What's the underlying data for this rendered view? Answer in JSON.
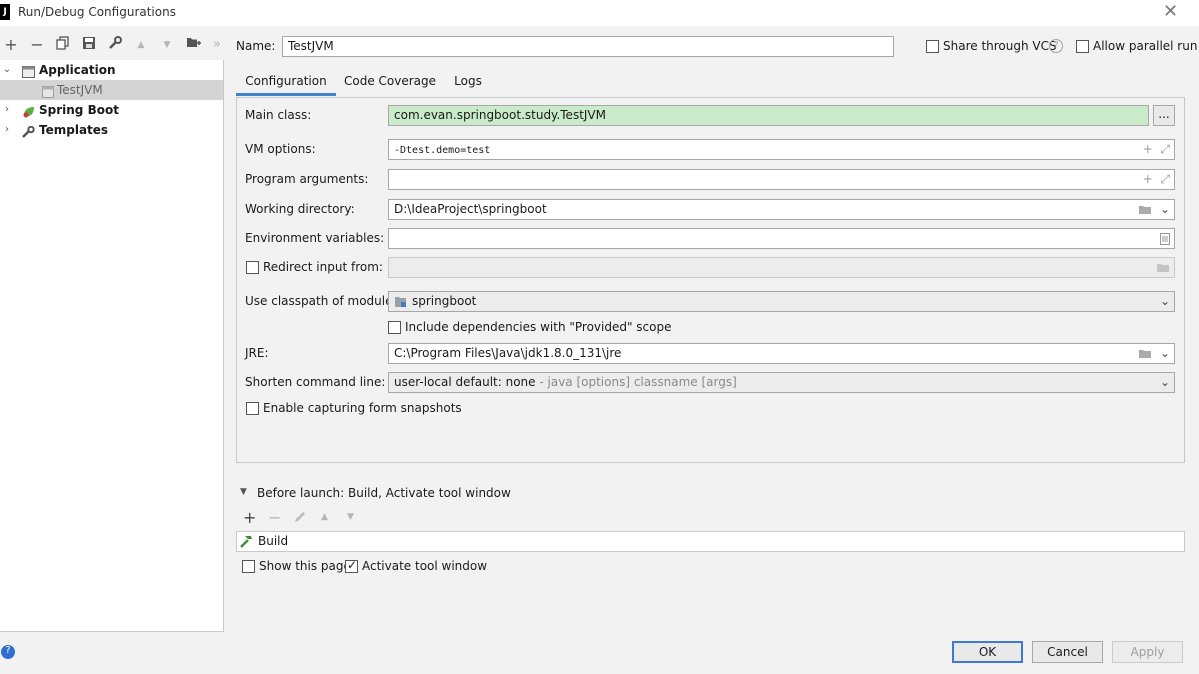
{
  "window": {
    "title": "Run/Debug Configurations",
    "app_icon_letter": "J"
  },
  "toolbar": {
    "add": "+",
    "remove": "−",
    "copy": "⧉",
    "save": "💾",
    "wrench": "🔧",
    "up": "▲",
    "down": "▼",
    "folder": "📁",
    "more": "»"
  },
  "tree": {
    "items": [
      {
        "label": "Application",
        "expanded": true,
        "bold": true
      },
      {
        "label": "TestJVM",
        "selected": true
      },
      {
        "label": "Spring Boot",
        "expanded": false,
        "bold": true
      },
      {
        "label": "Templates",
        "expanded": false,
        "bold": true
      }
    ]
  },
  "header": {
    "name_label": "Name:",
    "name_value": "TestJVM",
    "share_vcs_label": "Share through VCS",
    "allow_parallel_label": "Allow parallel run"
  },
  "tabs": [
    {
      "label": "Configuration",
      "active": true
    },
    {
      "label": "Code Coverage",
      "active": false
    },
    {
      "label": "Logs",
      "active": false
    }
  ],
  "form": {
    "main_class_label": "Main class:",
    "main_class_value": "com.evan.springboot.study.TestJVM",
    "browse_label": "...",
    "vm_options_label": "VM options:",
    "vm_options_value": "-Dtest.demo=test",
    "program_args_label": "Program arguments:",
    "program_args_value": "",
    "working_dir_label": "Working directory:",
    "working_dir_value": "D:\\IdeaProject\\springboot",
    "env_vars_label": "Environment variables:",
    "env_vars_value": "",
    "redirect_input_label": "Redirect input from:",
    "classpath_label": "Use classpath of module:",
    "classpath_value": "springboot",
    "include_deps_label": "Include dependencies with \"Provided\" scope",
    "jre_label": "JRE:",
    "jre_value": "C:\\Program Files\\Java\\jdk1.8.0_131\\jre",
    "shorten_label": "Shorten command line:",
    "shorten_value": "user-local default: none",
    "shorten_hint": "- java [options] classname [args]",
    "snapshots_label": "Enable capturing form snapshots"
  },
  "before_launch": {
    "title": "Before launch: Build, Activate tool window",
    "task": "Build",
    "show_page_label": "Show this page",
    "activate_label": "Activate tool window",
    "activate_checked": true
  },
  "footer": {
    "help": "?",
    "ok": "OK",
    "cancel": "Cancel",
    "apply": "Apply"
  },
  "colors": {
    "accent": "#4083c9",
    "main_class_bg": "#c9ebc9",
    "help_bg": "#2f6fd0"
  }
}
